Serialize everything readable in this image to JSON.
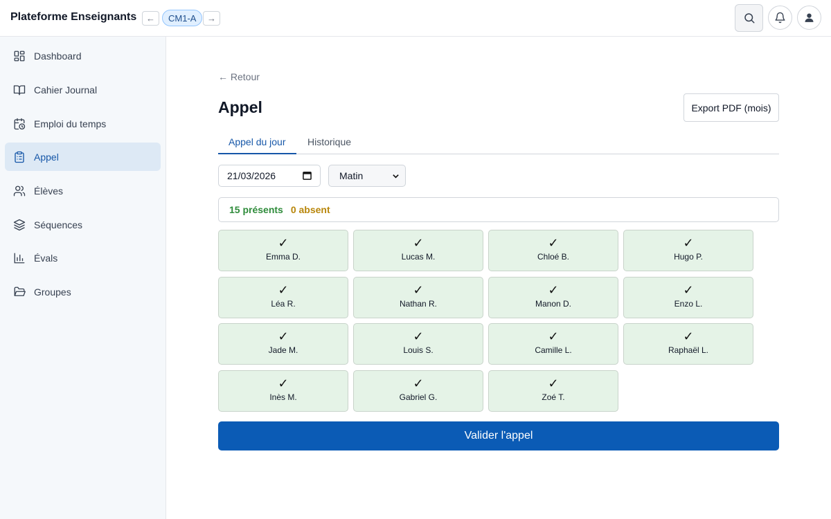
{
  "header": {
    "app_title": "Plateforme Enseignants",
    "prev_arrow": "←",
    "next_arrow": "→",
    "class_label": "CM1-A"
  },
  "sidebar": {
    "items": [
      {
        "label": "Dashboard",
        "icon": "dashboard-icon"
      },
      {
        "label": "Cahier Journal",
        "icon": "book-icon"
      },
      {
        "label": "Emploi du temps",
        "icon": "calendar-clock-icon"
      },
      {
        "label": "Appel",
        "icon": "clipboard-icon",
        "active": true
      },
      {
        "label": "Élèves",
        "icon": "users-icon"
      },
      {
        "label": "Séquences",
        "icon": "layers-icon"
      },
      {
        "label": "Évals",
        "icon": "bar-chart-icon"
      },
      {
        "label": "Groupes",
        "icon": "folder-icon"
      }
    ]
  },
  "main": {
    "back_label": "← Retour",
    "title": "Appel",
    "export_label": "Export PDF (mois)",
    "tabs": [
      {
        "label": "Appel du jour",
        "active": true
      },
      {
        "label": "Historique",
        "active": false
      }
    ],
    "date_value": "21/03/2026",
    "period_value": "Matin",
    "summary": {
      "present": "15 présents",
      "absent": "0 absent"
    },
    "check_glyph": "✓",
    "students": [
      "Emma D.",
      "Lucas M.",
      "Chloé B.",
      "Hugo P.",
      "Léa R.",
      "Nathan R.",
      "Manon D.",
      "Enzo L.",
      "Jade M.",
      "Louis S.",
      "Camille L.",
      "Raphaël L.",
      "Inès M.",
      "Gabriel G.",
      "Zoé T."
    ],
    "validate_label": "Valider l'appel"
  },
  "colors": {
    "accent": "#0b5bb5",
    "present": "#2e8b3a",
    "absent": "#b8860b",
    "card_bg": "#e5f3e7"
  }
}
